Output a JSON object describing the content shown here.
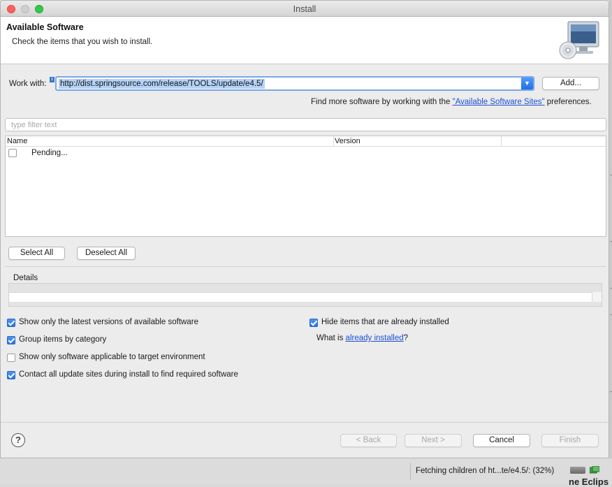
{
  "window": {
    "title": "Install"
  },
  "banner": {
    "title": "Available Software",
    "subtitle": "Check the items that you wish to install.",
    "icon": "monitor-cd-icon"
  },
  "work_with": {
    "label": "Work with:",
    "value": "http://dist.springsource.com/release/TOOLS/update/e4.5/",
    "add_button": "Add..."
  },
  "find_more": {
    "prefix": "Find more software by working with the ",
    "link": "\"Available Software Sites\"",
    "suffix": " preferences."
  },
  "filter": {
    "placeholder": "type filter text"
  },
  "table": {
    "columns": [
      "Name",
      "Version"
    ],
    "rows": [
      {
        "name": "Pending...",
        "checked": false
      }
    ]
  },
  "selection": {
    "select_all": "Select All",
    "deselect_all": "Deselect All"
  },
  "details": {
    "label": "Details"
  },
  "options": {
    "latest_versions": {
      "label": "Show only the latest versions of available software",
      "checked": true
    },
    "group_by_category": {
      "label": "Group items by category",
      "checked": true
    },
    "applicable_only": {
      "label": "Show only software applicable to target environment",
      "checked": false
    },
    "contact_sites": {
      "label": "Contact all update sites during install to find required software",
      "checked": true
    },
    "hide_installed": {
      "label": "Hide items that are already installed",
      "checked": true
    },
    "what_is": {
      "prefix": "What is ",
      "link": "already installed",
      "suffix": "?"
    }
  },
  "footer": {
    "help": "?",
    "back": "< Back",
    "next": "Next >",
    "cancel": "Cancel",
    "finish": "Finish"
  },
  "status": {
    "text": "Fetching children of ht...te/e4.5/: (32%)",
    "progress_percent": 32
  },
  "background": {
    "text": "ne Eclips"
  },
  "colors": {
    "accent": "#2a72e4",
    "link": "#1a4fd6",
    "selection": "#b4d3f7"
  }
}
